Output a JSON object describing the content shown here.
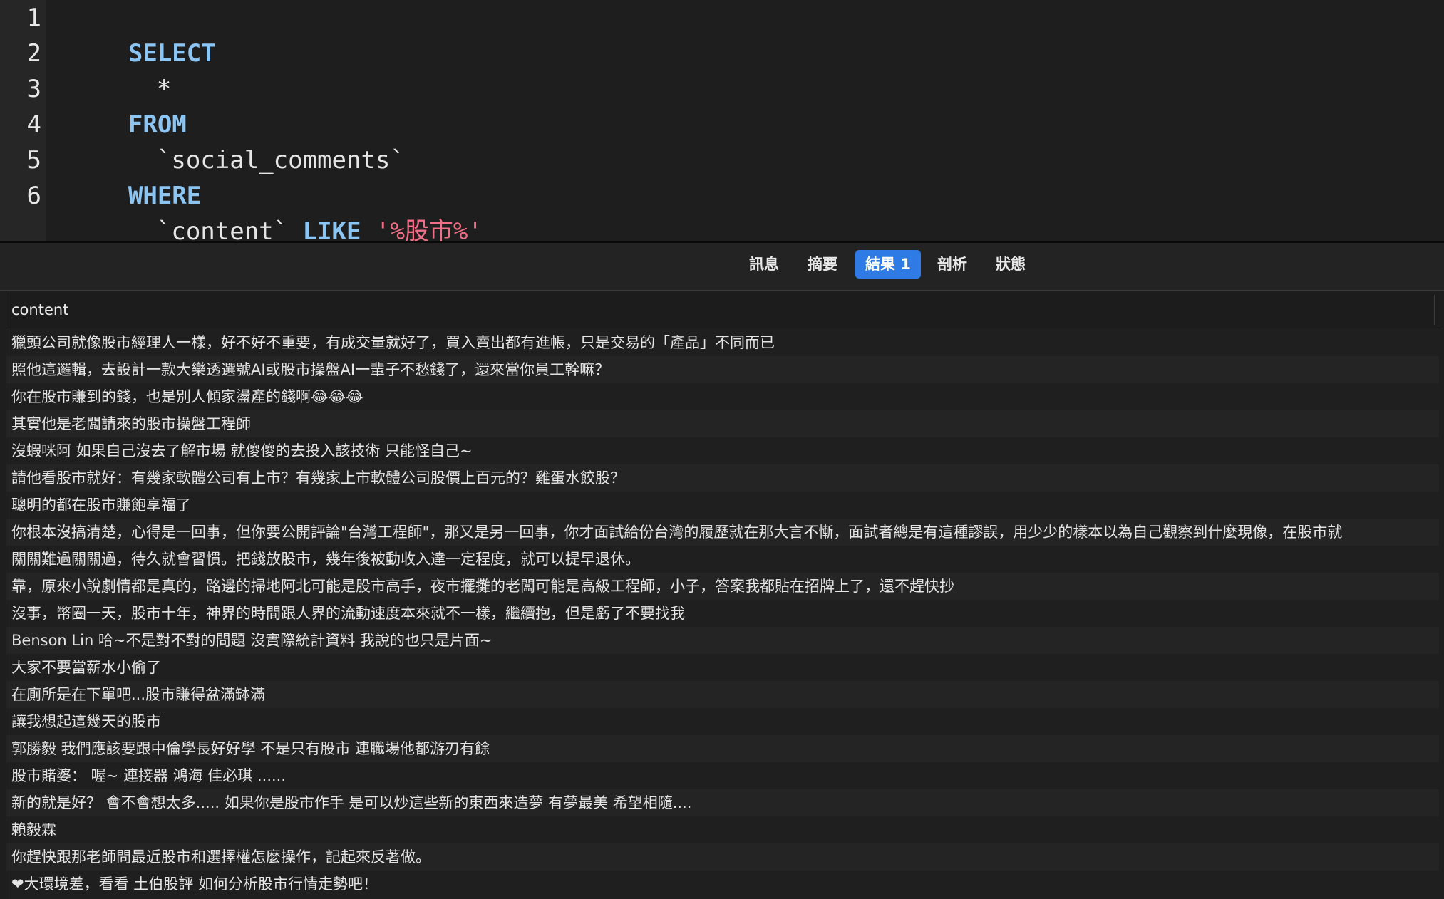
{
  "editor": {
    "line_numbers": [
      "1",
      "2",
      "3",
      "4",
      "5",
      "6"
    ],
    "sql": {
      "select": "SELECT",
      "star": "*",
      "from": "FROM",
      "table": "`social_comments`",
      "where": "WHERE",
      "column": "`content`",
      "like": "LIKE",
      "pattern": "'%股市%'"
    }
  },
  "tabs": [
    {
      "label": "訊息",
      "active": false
    },
    {
      "label": "摘要",
      "active": false
    },
    {
      "label": "結果 1",
      "active": true
    },
    {
      "label": "剖析",
      "active": false
    },
    {
      "label": "狀態",
      "active": false
    }
  ],
  "results": {
    "column_header": "content",
    "rows": [
      "獵頭公司就像股市經理人一樣，好不好不重要，有成交量就好了，買入賣出都有進帳，只是交易的「產品」不同而已",
      "照他這邏輯，去設計一款大樂透選號AI或股市操盤AI一輩子不愁錢了，還來當你員工幹嘛？",
      "你在股市賺到的錢，也是別人傾家盪產的錢啊😂😂😂",
      "其實他是老闆請來的股市操盤工程師",
      "沒蝦咪阿 如果自己沒去了解市場 就傻傻的去投入該技術 只能怪自己~",
      "請他看股市就好：有幾家軟體公司有上市？有幾家上市軟體公司股價上百元的？雞蛋水餃股？",
      "聰明的都在股市賺飽享福了",
      "你根本沒搞清楚，心得是一回事，但你要公開評論\"台灣工程師\"，那又是另一回事，你才面試給份台灣的履歷就在那大言不慚，面試者總是有這種謬誤，用少少的樣本以為自己觀察到什麼現像，在股市就",
      "關關難過關關過，待久就會習慣。把錢放股市，幾年後被動收入達一定程度，就可以提早退休。",
      "靠，原來小說劇情都是真的，路邊的掃地阿北可能是股市高手，夜市擺攤的老闆可能是高級工程師，小子，答案我都貼在招牌上了，還不趕快抄",
      "沒事，幣圈一天，股市十年，神界的時間跟人界的流動速度本來就不一樣，繼續抱，但是虧了不要找我",
      "Benson Lin 哈~不是對不對的問題  沒實際統計資料 我說的也只是片面~",
      "大家不要當薪水小偷了",
      "在廁所是在下單吧...股市賺得盆滿缽滿",
      "讓我想起這幾天的股市",
      "郭勝毅 我們應該要跟中倫學長好好學 不是只有股市 連職場他都游刃有餘",
      "股市賭婆： 喔~ 連接器 鴻海 佳必琪 ......",
      "新的就是好？ 會不會想太多..... 如果你是股市作手 是可以炒這些新的東西來造夢 有夢最美 希望相隨....",
      "賴毅霖",
      "你趕快跟那老師問最近股市和選擇權怎麼操作，記起來反著做。",
      "❤大環境差，看看 土伯股評 如何分析股市行情走勢吧！"
    ]
  },
  "colors": {
    "keyword": "#8cc4f2",
    "string": "#f16f86",
    "active_tab": "#2f7be5",
    "background": "#1e1e1e"
  }
}
